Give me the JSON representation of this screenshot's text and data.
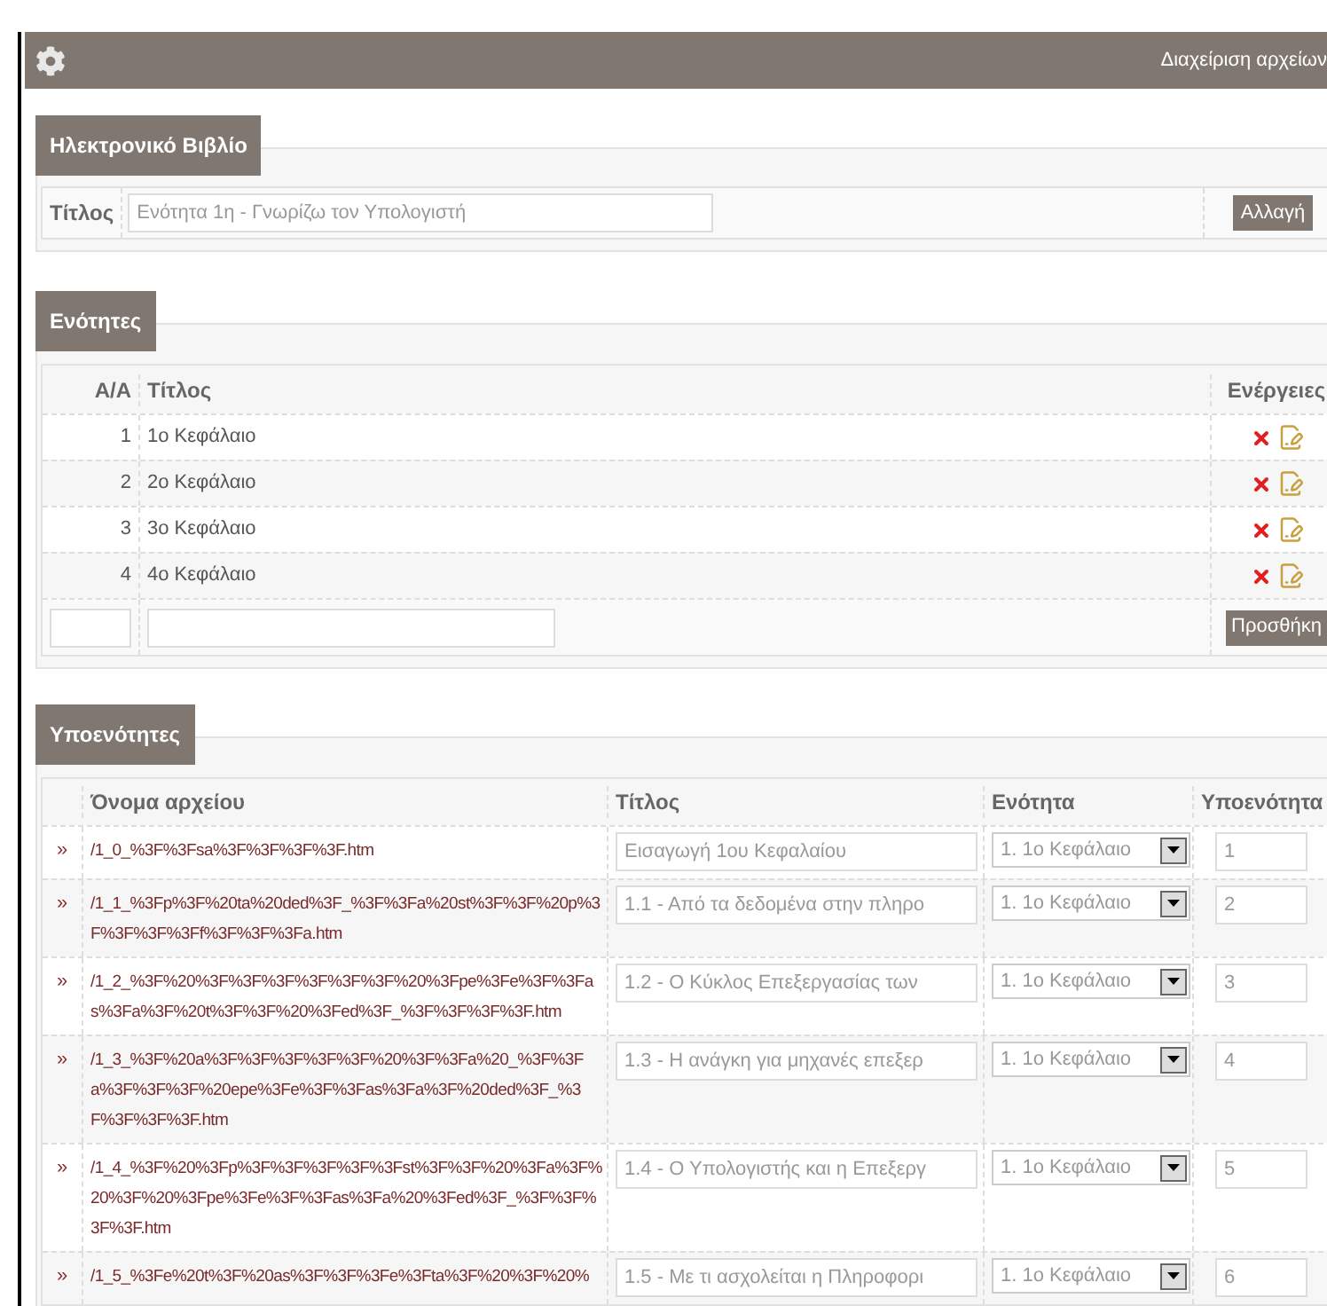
{
  "header": {
    "title": "Διαχείριση αρχείων"
  },
  "book": {
    "legend": "Ηλεκτρονικό Βιβλίο",
    "title_label": "Τίτλος",
    "title_value": "Ενότητα 1η - Γνωρίζω τον Υπολογιστή",
    "button": "Αλλαγή"
  },
  "sections": {
    "legend": "Ενότητες",
    "columns": [
      "Α/Α",
      "Τίτλος",
      "Ενέργειες"
    ],
    "rows": [
      {
        "number": "1",
        "title": "1ο Κεφάλαιο"
      },
      {
        "number": "2",
        "title": "2ο Κεφάλαιο"
      },
      {
        "number": "3",
        "title": "3ο Κεφάλαιο"
      },
      {
        "number": "4",
        "title": "4ο Κεφάλαιο"
      }
    ],
    "add_button": "Προσθήκη"
  },
  "subsections": {
    "legend": "Υποενότητες",
    "columns": [
      "Όνομα αρχείου",
      "Τίτλος",
      "Ενότητα",
      "Υποενότητα"
    ],
    "rows": [
      {
        "marker": "»",
        "file": "/1_0_%3F%3Fsa%3F%3F%3F%3F.htm",
        "title": "Εισαγωγή 1ου Κεφαλαίου",
        "section": "1. 1ο Κεφάλαιο",
        "number": "1"
      },
      {
        "marker": "»",
        "file": "/1_1_%3Fp%3F%20ta%20ded%3F_%3F%3Fa%20st%3F%3F%20p%3F%3F%3F%3Ff%3F%3F%3Fa.htm",
        "title": "1.1 - Από τα δεδομένα στην πληρο",
        "section": "1. 1ο Κεφάλαιο",
        "number": "2"
      },
      {
        "marker": "»",
        "file": "/1_2_%3F%20%3F%3F%3F%3F%3F%3F%20%3Fpe%3Fe%3F%3Fas%3Fa%3F%20t%3F%3F%20%3Fed%3F_%3F%3F%3F%3F.htm",
        "title": "1.2 - Ο Κύκλος Επεξεργασίας των",
        "section": "1. 1ο Κεφάλαιο",
        "number": "3"
      },
      {
        "marker": "»",
        "file": "/1_3_%3F%20a%3F%3F%3F%3F%3F%20%3F%3Fa%20_%3F%3Fa%3F%3F%3F%20epe%3Fe%3F%3Fas%3Fa%3F%20ded%3F_%3F%3F%3F%3F.htm",
        "title": "1.3 - Η ανάγκη για μηχανές επεξερ",
        "section": "1. 1ο Κεφάλαιο",
        "number": "4"
      },
      {
        "marker": "»",
        "file": "/1_4_%3F%20%3Fp%3F%3F%3F%3F%3Fst%3F%3F%20%3Fa%3F%20%3F%20%3Fpe%3Fe%3F%3Fas%3Fa%20%3Fed%3F_%3F%3F%3F%3F.htm",
        "title": "1.4 - Ο Υπολογιστής και η Επεξεργ",
        "section": "1. 1ο Κεφάλαιο",
        "number": "5"
      },
      {
        "marker": "»",
        "file": "/1_5_%3Fe%20t%3F%20as%3F%3F%3Fe%3Fta%3F%20%3F%20%",
        "title": "1.5 - Με τι ασχολείται η Πληροφορι",
        "section": "1. 1ο Κεφάλαιο",
        "number": "6"
      }
    ]
  }
}
